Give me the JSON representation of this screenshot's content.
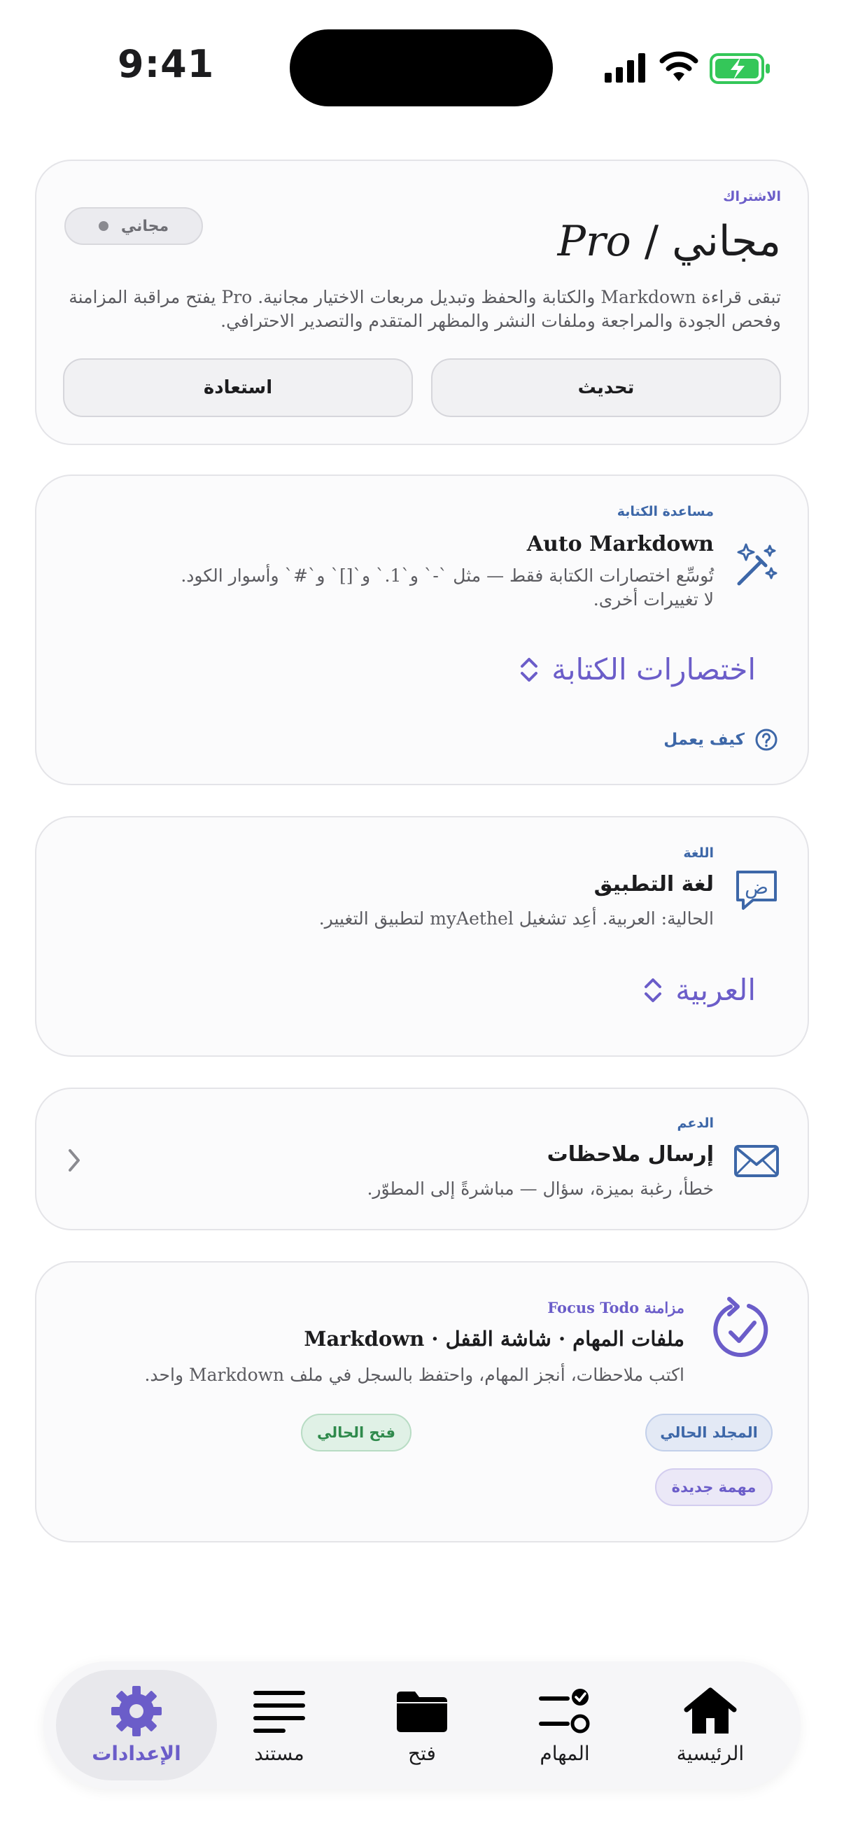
{
  "status_bar": {
    "time": "9:41"
  },
  "subscription": {
    "eyebrow": "الاشتراك",
    "title_ar": "مجاني",
    "title_sep": " / ",
    "title_pro": "Pro",
    "badge": "مجاني",
    "description": "تبقى قراءة Markdown والكتابة والحفظ وتبديل مربعات الاختيار مجانية. Pro يفتح مراقبة المزامنة وفحص الجودة والمراجعة وملفات النشر والمظهر المتقدم والتصدير الاحترافي.",
    "update_label": "تحديث",
    "restore_label": "استعادة"
  },
  "writing": {
    "eyebrow": "مساعدة الكتابة",
    "title": "Auto Markdown",
    "description": "تُوسِّع اختصارات الكتابة فقط — مثل `-` و`1.` و`[]` و`#` وأسوار الكود. لا تغييرات أخرى.",
    "picker_value": "اختصارات الكتابة",
    "how_label": "كيف يعمل",
    "icon": "magic-wand-icon"
  },
  "language": {
    "eyebrow": "اللغة",
    "title": "لغة التطبيق",
    "description": "الحالية: العربية. أعِد تشغيل myAethel لتطبيق التغيير.",
    "picker_value": "العربية",
    "icon": "language-bubble-icon"
  },
  "support": {
    "eyebrow": "الدعم",
    "title": "إرسال ملاحظات",
    "description": "خطأ، رغبة بميزة، سؤال — مباشرةً إلى المطوّر.",
    "icon": "envelope-icon"
  },
  "focus_todo": {
    "eyebrow": "مزامنة Focus Todo",
    "title": "ملفات المهام · شاشة القفل · Markdown",
    "description": "اكتب ملاحظات، أنجز المهام، واحتفظ بالسجل في ملف Markdown واحد.",
    "chip_folder": "المجلد الحالي",
    "chip_open": "فتح الحالي",
    "chip_new": "مهمة جديدة",
    "icon": "circular-check-icon"
  },
  "tabs": [
    {
      "label": "الرئيسية",
      "icon": "home-icon"
    },
    {
      "label": "المهام",
      "icon": "tasks-icon"
    },
    {
      "label": "فتح",
      "icon": "folder-icon"
    },
    {
      "label": "مستند",
      "icon": "document-lines-icon"
    },
    {
      "label": "الإعدادات",
      "icon": "gear-icon"
    }
  ],
  "colors": {
    "accent": "#6b5dc9",
    "link": "#3d67a8",
    "battery": "#34c759"
  }
}
